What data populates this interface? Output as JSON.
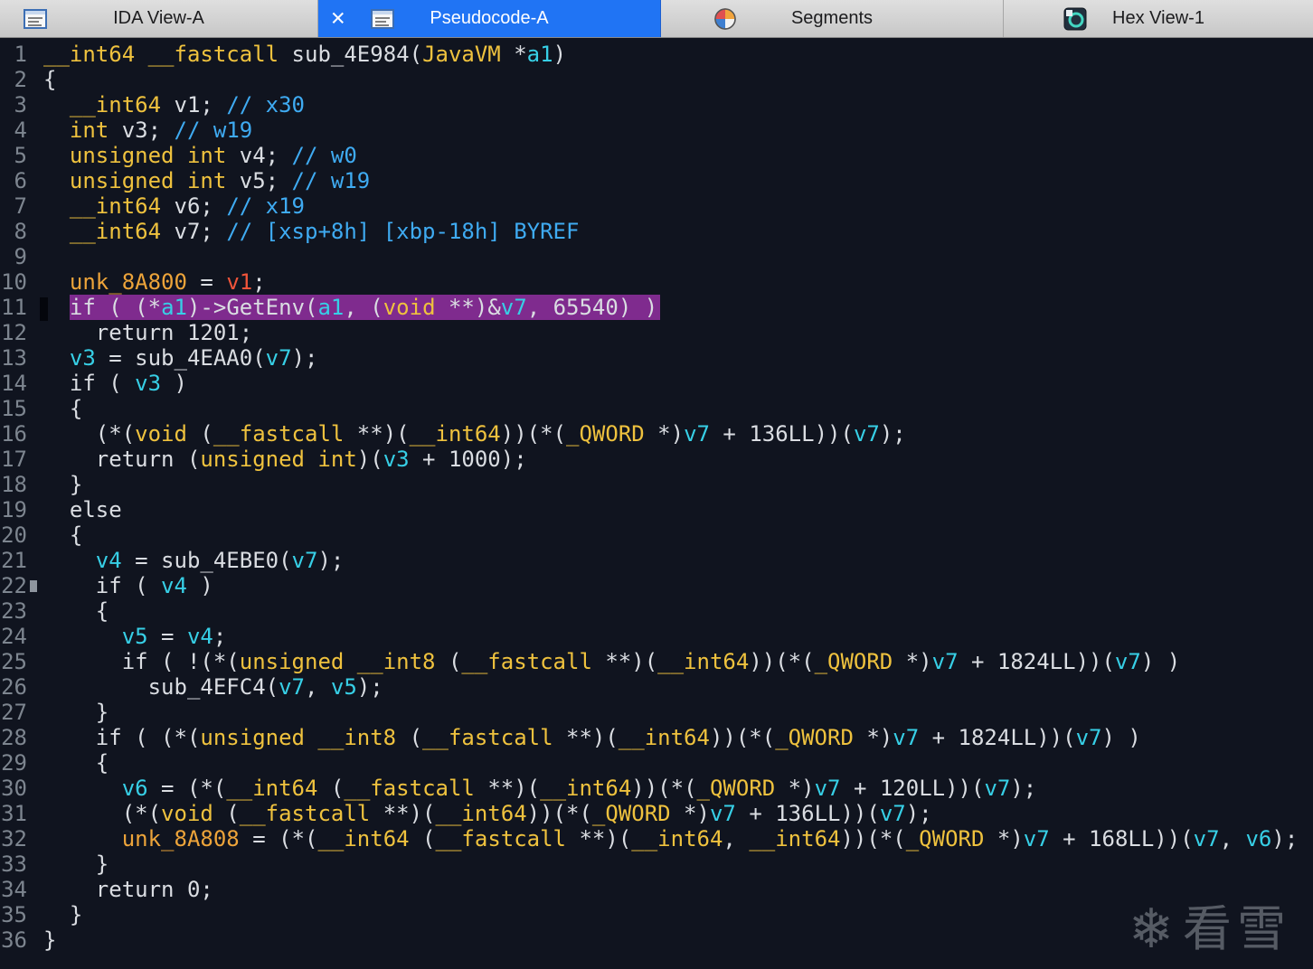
{
  "tabs": [
    {
      "label": "IDA View-A",
      "icon": "text-view-icon",
      "active": false
    },
    {
      "label": "Pseudocode-A",
      "icon": "text-view-icon",
      "active": true,
      "close_label": "✕"
    },
    {
      "label": "Segments",
      "icon": "segments-icon",
      "active": false
    },
    {
      "label": "Hex View-1",
      "icon": "hex-view-icon",
      "active": false
    }
  ],
  "colors": {
    "background": "#10141f",
    "tab_active_blue": "#2074f4",
    "keyword_yellow": "#efc23e",
    "variable_cyan": "#37cfe6",
    "comment_blue": "#3fabf2",
    "global_orange": "#eda43a",
    "error_var_red": "#f0543a",
    "highlight_purple": "#7f2b8e",
    "line_number_gray": "#7d858f",
    "default_text": "#dadde2"
  },
  "watermark": {
    "icon": "snowflake-icon",
    "icon_glyph": "❄",
    "text": "看雪"
  },
  "code": {
    "function_name": "sub_4E984",
    "lines": [
      {
        "num": 1,
        "tokens": [
          [
            "k",
            "__int64"
          ],
          [
            "p",
            " "
          ],
          [
            "k",
            "__fastcall"
          ],
          [
            "p",
            " sub_4E984("
          ],
          [
            "k",
            "JavaVM"
          ],
          [
            "p",
            " *"
          ],
          [
            "v",
            "a1"
          ],
          [
            "p",
            ")"
          ]
        ]
      },
      {
        "num": 2,
        "tokens": [
          [
            "p",
            "{"
          ]
        ]
      },
      {
        "num": 3,
        "tokens": [
          [
            "p",
            "  "
          ],
          [
            "k",
            "__int64"
          ],
          [
            "p",
            " v1; "
          ],
          [
            "c",
            "// x30"
          ]
        ]
      },
      {
        "num": 4,
        "tokens": [
          [
            "p",
            "  "
          ],
          [
            "k",
            "int"
          ],
          [
            "p",
            " v3; "
          ],
          [
            "c",
            "// w19"
          ]
        ]
      },
      {
        "num": 5,
        "tokens": [
          [
            "p",
            "  "
          ],
          [
            "k",
            "unsigned int"
          ],
          [
            "p",
            " v4; "
          ],
          [
            "c",
            "// w0"
          ]
        ]
      },
      {
        "num": 6,
        "tokens": [
          [
            "p",
            "  "
          ],
          [
            "k",
            "unsigned int"
          ],
          [
            "p",
            " v5; "
          ],
          [
            "c",
            "// w19"
          ]
        ]
      },
      {
        "num": 7,
        "tokens": [
          [
            "p",
            "  "
          ],
          [
            "k",
            "__int64"
          ],
          [
            "p",
            " v6; "
          ],
          [
            "c",
            "// x19"
          ]
        ]
      },
      {
        "num": 8,
        "tokens": [
          [
            "p",
            "  "
          ],
          [
            "k",
            "__int64"
          ],
          [
            "p",
            " v7; "
          ],
          [
            "c",
            "// [xsp+8h] [xbp-18h] BYREF"
          ]
        ]
      },
      {
        "num": 9,
        "tokens": []
      },
      {
        "num": 10,
        "tokens": [
          [
            "p",
            "  "
          ],
          [
            "g",
            "unk_8A800"
          ],
          [
            "p",
            " = "
          ],
          [
            "r",
            "v1"
          ],
          [
            "p",
            ";"
          ]
        ]
      },
      {
        "num": 11,
        "hl_from": 1,
        "tokens": [
          [
            "p",
            "  "
          ],
          [
            "p",
            "if ( (*"
          ],
          [
            "v",
            "a1"
          ],
          [
            "p",
            ")->GetEnv("
          ],
          [
            "v",
            "a1"
          ],
          [
            "p",
            ", ("
          ],
          [
            "k",
            "void"
          ],
          [
            "p",
            " **)&"
          ],
          [
            "v",
            "v7"
          ],
          [
            "p",
            ", 65540) )"
          ]
        ]
      },
      {
        "num": 12,
        "tokens": [
          [
            "p",
            "    return 1201;"
          ]
        ]
      },
      {
        "num": 13,
        "tokens": [
          [
            "p",
            "  "
          ],
          [
            "v",
            "v3"
          ],
          [
            "p",
            " = sub_4EAA0("
          ],
          [
            "v",
            "v7"
          ],
          [
            "p",
            ");"
          ]
        ]
      },
      {
        "num": 14,
        "tokens": [
          [
            "p",
            "  if ( "
          ],
          [
            "v",
            "v3"
          ],
          [
            "p",
            " )"
          ]
        ]
      },
      {
        "num": 15,
        "tokens": [
          [
            "p",
            "  {"
          ]
        ]
      },
      {
        "num": 16,
        "tokens": [
          [
            "p",
            "    (*("
          ],
          [
            "k",
            "void"
          ],
          [
            "p",
            " ("
          ],
          [
            "k",
            "__fastcall"
          ],
          [
            "p",
            " **)("
          ],
          [
            "k",
            "__int64"
          ],
          [
            "p",
            "))(*("
          ],
          [
            "k",
            "_QWORD"
          ],
          [
            "p",
            " *)"
          ],
          [
            "v",
            "v7"
          ],
          [
            "p",
            " + 136LL))("
          ],
          [
            "v",
            "v7"
          ],
          [
            "p",
            ");"
          ]
        ]
      },
      {
        "num": 17,
        "tokens": [
          [
            "p",
            "    return ("
          ],
          [
            "k",
            "unsigned int"
          ],
          [
            "p",
            ")("
          ],
          [
            "v",
            "v3"
          ],
          [
            "p",
            " + 1000);"
          ]
        ]
      },
      {
        "num": 18,
        "tokens": [
          [
            "p",
            "  }"
          ]
        ]
      },
      {
        "num": 19,
        "tokens": [
          [
            "p",
            "  else"
          ]
        ]
      },
      {
        "num": 20,
        "tokens": [
          [
            "p",
            "  {"
          ]
        ]
      },
      {
        "num": 21,
        "tokens": [
          [
            "p",
            "    "
          ],
          [
            "v",
            "v4"
          ],
          [
            "p",
            " = sub_4EBE0("
          ],
          [
            "v",
            "v7"
          ],
          [
            "p",
            ");"
          ]
        ]
      },
      {
        "num": 22,
        "tokens": [
          [
            "p",
            "    if ( "
          ],
          [
            "v",
            "v4"
          ],
          [
            "p",
            " )"
          ]
        ]
      },
      {
        "num": 23,
        "tokens": [
          [
            "p",
            "    {"
          ]
        ]
      },
      {
        "num": 24,
        "tokens": [
          [
            "p",
            "      "
          ],
          [
            "v",
            "v5"
          ],
          [
            "p",
            " = "
          ],
          [
            "v",
            "v4"
          ],
          [
            "p",
            ";"
          ]
        ]
      },
      {
        "num": 25,
        "tokens": [
          [
            "p",
            "      if ( !(*("
          ],
          [
            "k",
            "unsigned __int8"
          ],
          [
            "p",
            " ("
          ],
          [
            "k",
            "__fastcall"
          ],
          [
            "p",
            " **)("
          ],
          [
            "k",
            "__int64"
          ],
          [
            "p",
            "))(*("
          ],
          [
            "k",
            "_QWORD"
          ],
          [
            "p",
            " *)"
          ],
          [
            "v",
            "v7"
          ],
          [
            "p",
            " + 1824LL))("
          ],
          [
            "v",
            "v7"
          ],
          [
            "p",
            ") )"
          ]
        ]
      },
      {
        "num": 26,
        "tokens": [
          [
            "p",
            "        sub_4EFC4("
          ],
          [
            "v",
            "v7"
          ],
          [
            "p",
            ", "
          ],
          [
            "v",
            "v5"
          ],
          [
            "p",
            ");"
          ]
        ]
      },
      {
        "num": 27,
        "tokens": [
          [
            "p",
            "    }"
          ]
        ]
      },
      {
        "num": 28,
        "tokens": [
          [
            "p",
            "    if ( (*("
          ],
          [
            "k",
            "unsigned __int8"
          ],
          [
            "p",
            " ("
          ],
          [
            "k",
            "__fastcall"
          ],
          [
            "p",
            " **)("
          ],
          [
            "k",
            "__int64"
          ],
          [
            "p",
            "))(*("
          ],
          [
            "k",
            "_QWORD"
          ],
          [
            "p",
            " *)"
          ],
          [
            "v",
            "v7"
          ],
          [
            "p",
            " + 1824LL))("
          ],
          [
            "v",
            "v7"
          ],
          [
            "p",
            ") )"
          ]
        ]
      },
      {
        "num": 29,
        "tokens": [
          [
            "p",
            "    {"
          ]
        ]
      },
      {
        "num": 30,
        "tokens": [
          [
            "p",
            "      "
          ],
          [
            "v",
            "v6"
          ],
          [
            "p",
            " = (*("
          ],
          [
            "k",
            "__int64"
          ],
          [
            "p",
            " ("
          ],
          [
            "k",
            "__fastcall"
          ],
          [
            "p",
            " **)("
          ],
          [
            "k",
            "__int64"
          ],
          [
            "p",
            "))(*("
          ],
          [
            "k",
            "_QWORD"
          ],
          [
            "p",
            " *)"
          ],
          [
            "v",
            "v7"
          ],
          [
            "p",
            " + 120LL))("
          ],
          [
            "v",
            "v7"
          ],
          [
            "p",
            ");"
          ]
        ]
      },
      {
        "num": 31,
        "tokens": [
          [
            "p",
            "      (*("
          ],
          [
            "k",
            "void"
          ],
          [
            "p",
            " ("
          ],
          [
            "k",
            "__fastcall"
          ],
          [
            "p",
            " **)("
          ],
          [
            "k",
            "__int64"
          ],
          [
            "p",
            "))(*("
          ],
          [
            "k",
            "_QWORD"
          ],
          [
            "p",
            " *)"
          ],
          [
            "v",
            "v7"
          ],
          [
            "p",
            " + 136LL))("
          ],
          [
            "v",
            "v7"
          ],
          [
            "p",
            ");"
          ]
        ]
      },
      {
        "num": 32,
        "tokens": [
          [
            "p",
            "      "
          ],
          [
            "g",
            "unk_8A808"
          ],
          [
            "p",
            " = (*("
          ],
          [
            "k",
            "__int64"
          ],
          [
            "p",
            " ("
          ],
          [
            "k",
            "__fastcall"
          ],
          [
            "p",
            " **)("
          ],
          [
            "k",
            "__int64"
          ],
          [
            "p",
            ", "
          ],
          [
            "k",
            "__int64"
          ],
          [
            "p",
            "))(*("
          ],
          [
            "k",
            "_QWORD"
          ],
          [
            "p",
            " *)"
          ],
          [
            "v",
            "v7"
          ],
          [
            "p",
            " + 168LL))("
          ],
          [
            "v",
            "v7"
          ],
          [
            "p",
            ", "
          ],
          [
            "v",
            "v6"
          ],
          [
            "p",
            ");"
          ]
        ]
      },
      {
        "num": 33,
        "tokens": [
          [
            "p",
            "    }"
          ]
        ]
      },
      {
        "num": 34,
        "tokens": [
          [
            "p",
            "    return 0;"
          ]
        ]
      },
      {
        "num": 35,
        "tokens": [
          [
            "p",
            "  }"
          ]
        ]
      },
      {
        "num": 36,
        "tokens": [
          [
            "p",
            "}"
          ]
        ]
      }
    ]
  }
}
